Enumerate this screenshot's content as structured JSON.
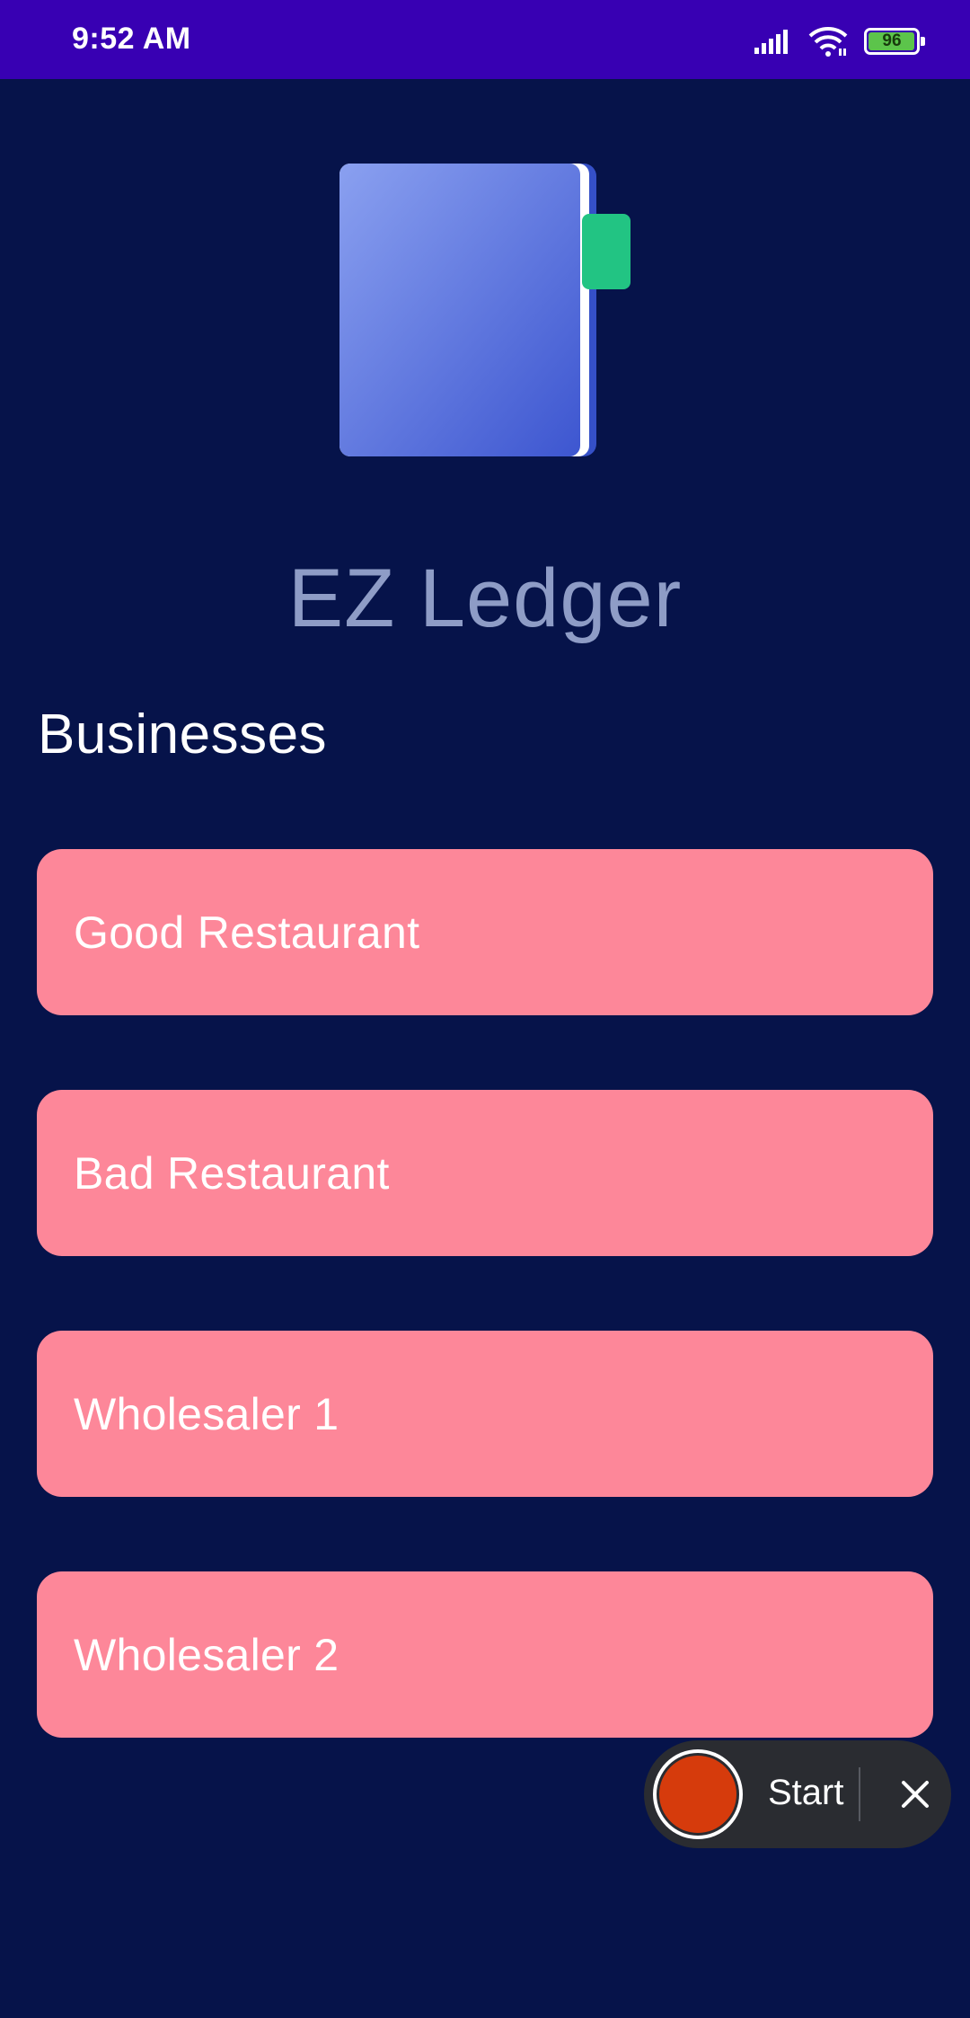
{
  "status_bar": {
    "time": "9:52 AM",
    "battery_level": "96",
    "signal_icon": "cellular-signal-icon",
    "wifi_icon": "wifi-icon",
    "battery_icon": "battery-icon",
    "background_color": "#3800b3"
  },
  "app": {
    "title": "EZ Ledger",
    "logo_icon": "ledger-book-icon",
    "background_color": "#06134a"
  },
  "businesses": {
    "heading": "Businesses",
    "card_color": "#fd8799",
    "items": [
      {
        "label": "Good Restaurant"
      },
      {
        "label": "Bad Restaurant"
      },
      {
        "label": "Wholesaler 1"
      },
      {
        "label": "Wholesaler 2"
      }
    ]
  },
  "recorder": {
    "start_label": "Start",
    "record_icon": "record-icon",
    "close_icon": "close-icon",
    "record_color": "#d63b0c"
  }
}
